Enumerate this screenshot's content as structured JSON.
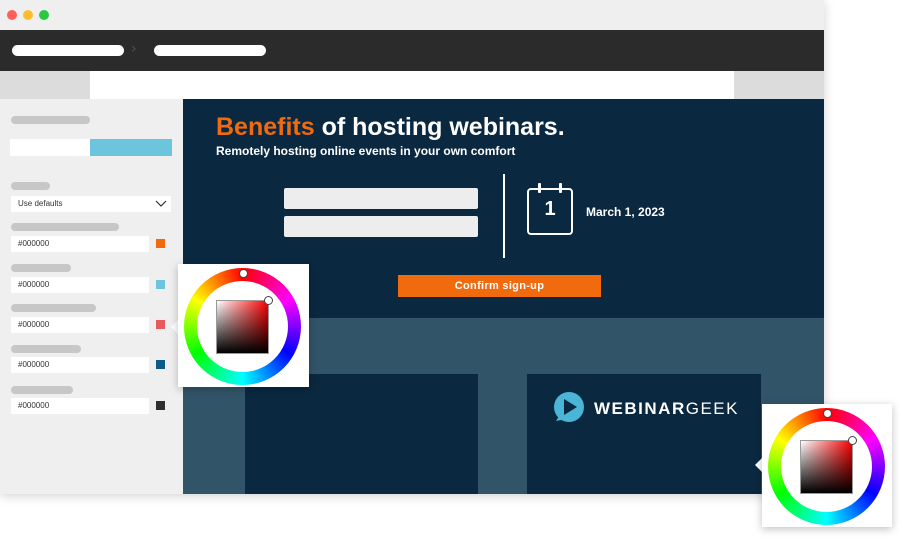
{
  "colors": {
    "window_titlebar": "#efefef",
    "toolbar": "#2b2b2b",
    "hero_bg": "#0a2840",
    "lower_bg": "#325468",
    "accent": "#f26a0e",
    "sidebar_bg": "#efefef",
    "tab_highlight": "#6cc5dc"
  },
  "sidebar": {
    "select_value": "Use defaults",
    "color_fields": [
      {
        "value": "#000000",
        "swatch": "#f26a0e"
      },
      {
        "value": "#000000",
        "swatch": "#6cc5dc"
      },
      {
        "value": "#000000",
        "swatch": "#e85b5b"
      },
      {
        "value": "#000000",
        "swatch": "#0a5a8a"
      },
      {
        "value": "#000000",
        "swatch": "#2f2f2f"
      }
    ]
  },
  "hero": {
    "title_accent": "Benefits",
    "title_rest": "of hosting webinars.",
    "subtitle": "Remotely hosting online events in your own comfort",
    "calendar_day": "1",
    "date": "March 1, 2023",
    "confirm_label": "Confirm sign-up"
  },
  "logo": {
    "text_bold": "WEBINAR",
    "text_regular": "GEEK"
  },
  "icons": {
    "calendar": "calendar-icon",
    "logo": "webinargeek-logo-icon",
    "select_arrow": "chevron-down-icon",
    "breadcrumb_separator": "chevron-right-icon"
  }
}
